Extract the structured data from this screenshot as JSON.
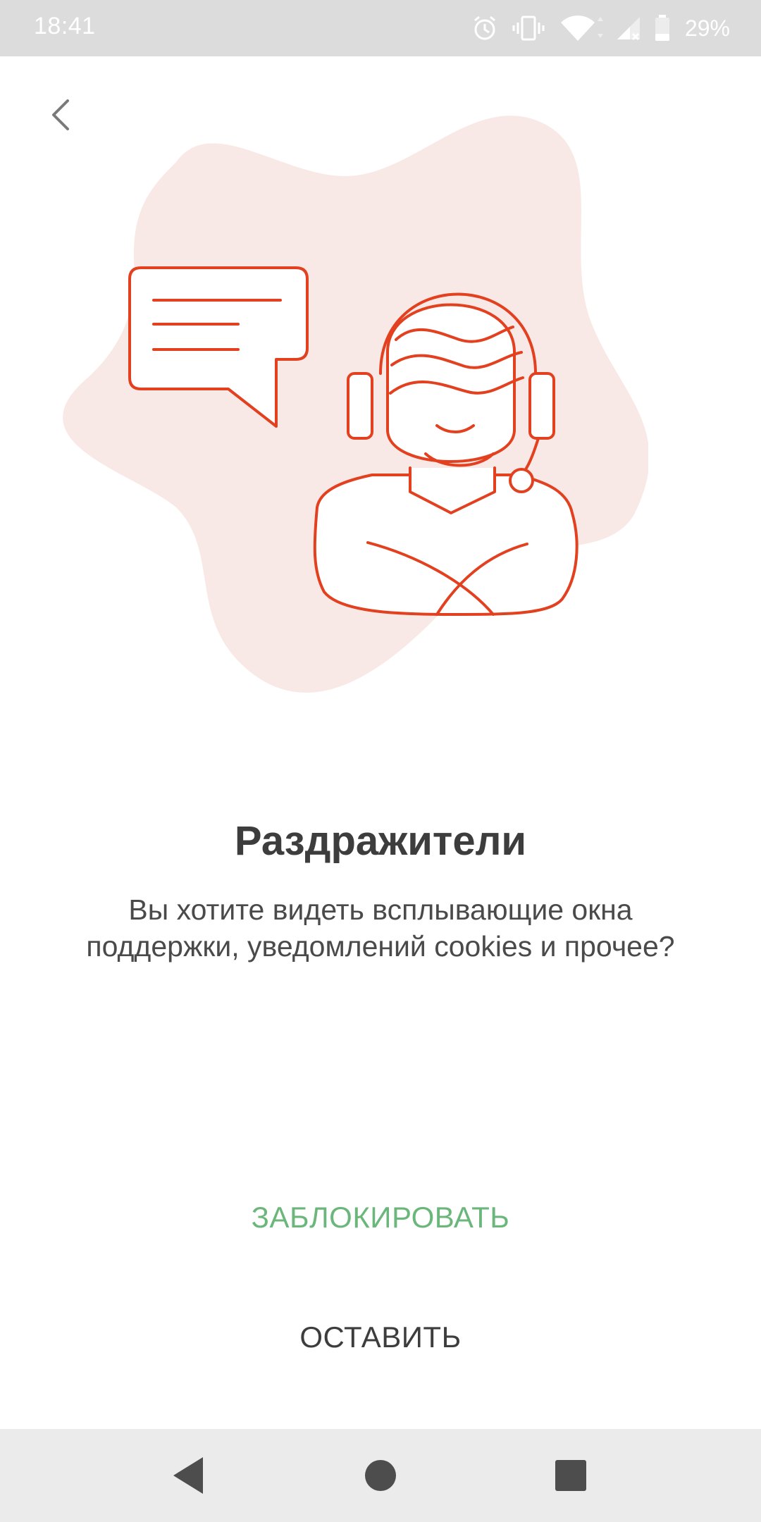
{
  "status_bar": {
    "time": "18:41",
    "battery": "29%",
    "icons": [
      "alarm-icon",
      "vibrate-icon",
      "wifi-icon",
      "signal-icon",
      "battery-icon"
    ]
  },
  "header": {
    "back_icon": "chevron-left-icon"
  },
  "illustration": {
    "icons": [
      "support-operator-icon",
      "chat-bubble-icon"
    ],
    "colors": {
      "line": "#e2401f",
      "blob": "#f9e9e6"
    }
  },
  "content": {
    "title": "Раздражители",
    "description": "Вы хотите видеть всплывающие окна поддержки, уведомлений cookies и прочее?"
  },
  "actions": {
    "block_label": "ЗАБЛОКИРОВАТЬ",
    "keep_label": "ОСТАВИТЬ",
    "block_color": "#6bb77b",
    "keep_color": "#3d3d3d"
  },
  "nav_bar": {
    "icons": [
      "back-triangle-icon",
      "home-circle-icon",
      "recents-square-icon"
    ]
  }
}
